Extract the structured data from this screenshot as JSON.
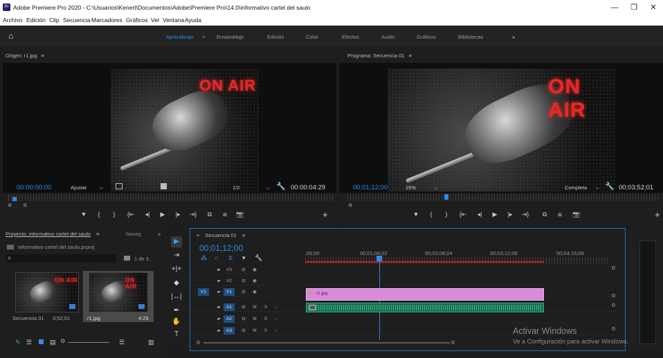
{
  "window": {
    "app_icon": "Pr",
    "title": "Adobe Premiere Pro 2020 - C:\\Usuarios\\Kenert\\Documentos\\Adobe\\Premiere Pro\\14.0\\informativo cartel del saulo",
    "minimize": "—",
    "maximize": "❐",
    "close": "✕"
  },
  "menu": [
    "Archivo",
    "Edición",
    "Clip",
    "Secuencia",
    "Marcadores",
    "Gráficos",
    "Ver",
    "Ventana",
    "Ayuda"
  ],
  "workspaces": {
    "home": "⌂",
    "items": [
      "Aprendizaje",
      "≡",
      "Ensamblaje",
      "Edición",
      "Color",
      "Efectos",
      "Audio",
      "Gráficos",
      "Bibliotecas",
      "»"
    ],
    "active": "Aprendizaje"
  },
  "source_monitor": {
    "title": "Origen: r1.jpg",
    "menu": "≡",
    "image_text": "ON AIR",
    "timecode": "00:00:00:00",
    "fit": "Ajustar",
    "fit_arrow": "⌵",
    "resolution": "1/2",
    "duration": "00:00:04:29"
  },
  "program_monitor": {
    "title": "Programa: Secuencia 01",
    "menu": "≡",
    "image_text": "ON AIR",
    "timecode": "00;01;12;00",
    "zoom": "25%",
    "zoom_arrow": "⌵",
    "quality": "Completa",
    "quality_arrow": "⌵",
    "duration": "00;03;52;01"
  },
  "transport_buttons": [
    "▼",
    "{",
    "}",
    "{⇤",
    "◂|",
    "▶",
    "|▸",
    "⇥}",
    "⧉",
    "⧈",
    "📷"
  ],
  "project_panel": {
    "title": "Proyecto: informativo cartel del saulo",
    "menu": "≡",
    "tab2": "Naveg",
    "more": "»",
    "file": "informativo cartel del saulo.prproj",
    "search_icon": "⌕",
    "item_count": "1 de 3..",
    "items": [
      {
        "name": "Secuencia 01",
        "duration": "3;52;01"
      },
      {
        "name": "r1.jpg",
        "duration": "4:29"
      }
    ]
  },
  "tools": [
    "▶",
    "⇥",
    "+|+",
    "◆",
    "|↔|",
    "✒",
    "✋",
    "T"
  ],
  "timeline": {
    "title": "Secuencia 01",
    "close": "×",
    "menu": "≡",
    "timecode": "00;01;12;00",
    "ruler_labels": [
      ";00;00",
      "00;01;04;02",
      "00;02;08;04",
      "00;03;12;06",
      "00;04;16;08"
    ],
    "video_tracks": [
      "V3",
      "V2",
      "V1"
    ],
    "audio_tracks": [
      "A1",
      "A2",
      "A3"
    ],
    "track_buttons": {
      "lock": "🔒",
      "eye": "◉",
      "toggle": "⊟",
      "mute": "M",
      "solo": "S",
      "mic": "🎙"
    },
    "source_patch": "V1",
    "clip_name": "r1.jpg",
    "playhead_fraction": 0.31
  },
  "watermark": {
    "line1": "Activar Windows",
    "line2": "Ve a Configuración para activar Windows."
  }
}
